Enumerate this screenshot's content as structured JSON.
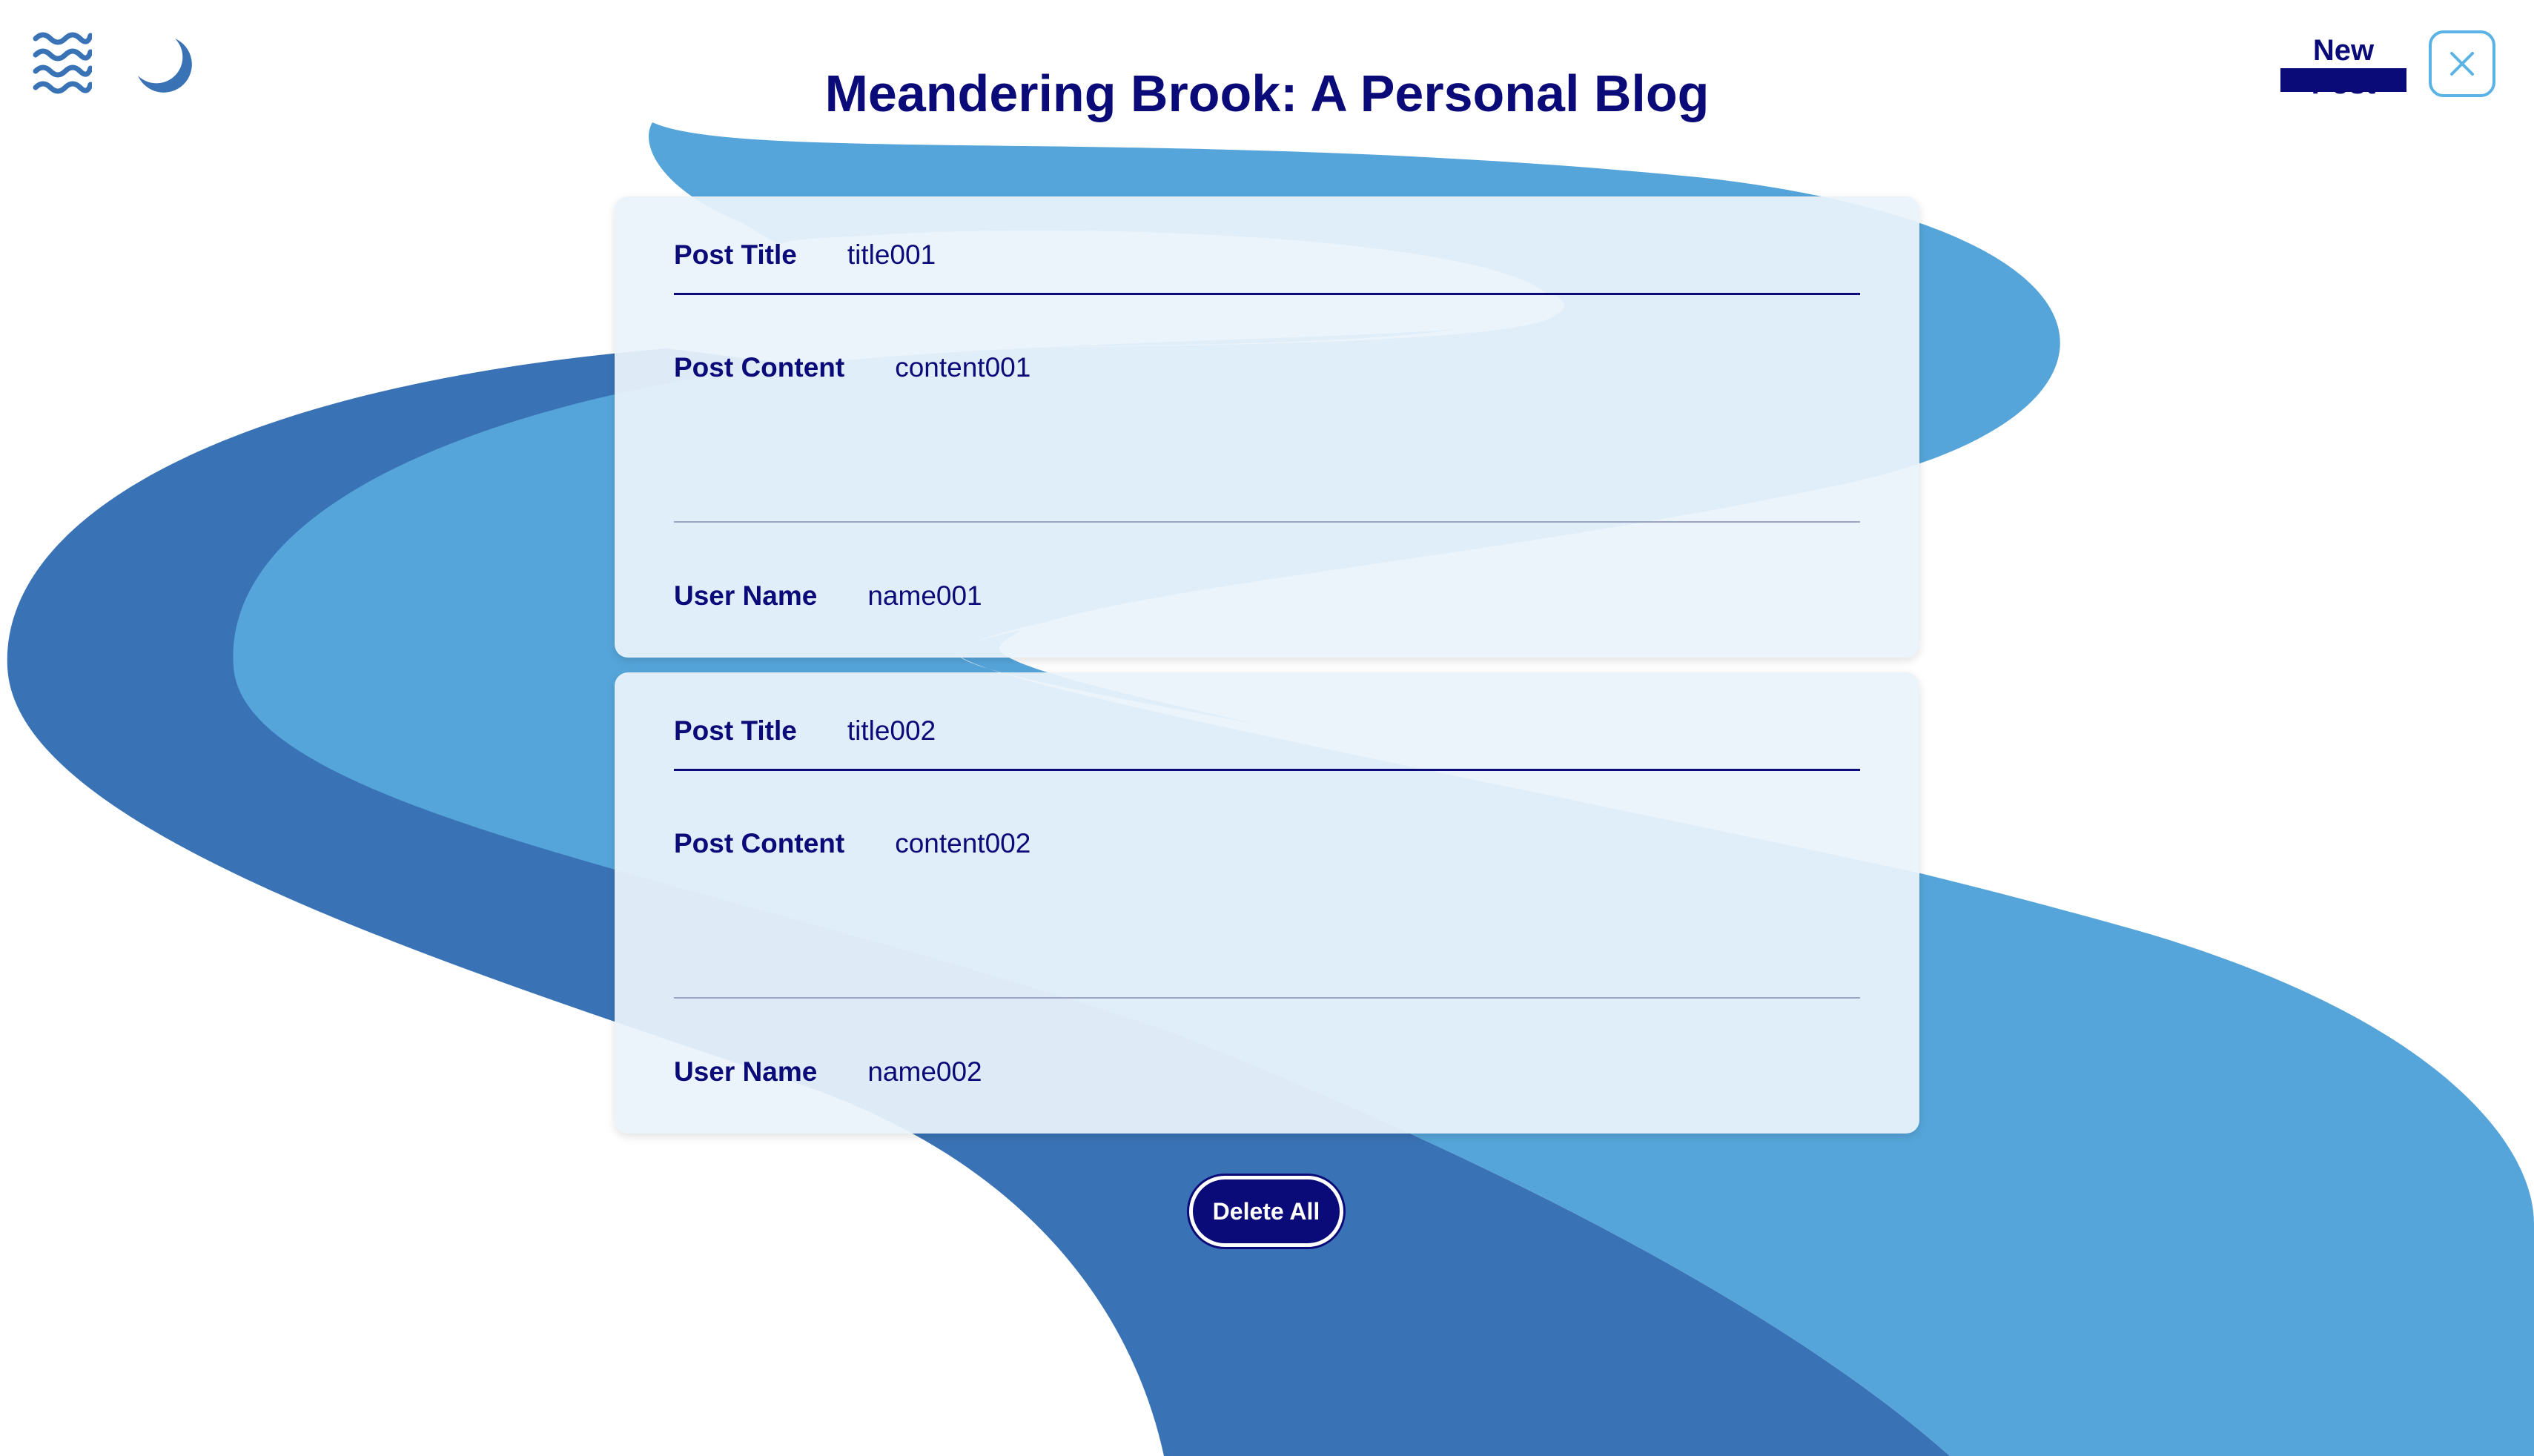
{
  "header": {
    "title": "Meandering Brook: A Personal Blog",
    "new_post_label": "New Post",
    "logo_icon": "waves-icon",
    "theme_icon": "moon-icon",
    "close_icon": "close-icon"
  },
  "posts": [
    {
      "title_label": "Post Title",
      "title_value": "title001",
      "content_label": "Post Content",
      "content_value": "content001",
      "user_label": "User Name",
      "user_value": "name001"
    },
    {
      "title_label": "Post Title",
      "title_value": "title002",
      "content_label": "Post Content",
      "content_value": "content002",
      "user_label": "User Name",
      "user_value": "name002"
    }
  ],
  "actions": {
    "delete_all_label": "Delete All"
  },
  "colors": {
    "navy": "#0a0a78",
    "river_dark": "#3a73b5",
    "river_light": "#55a5da",
    "card_bg": "#ebf3fb",
    "close_border": "#5bb2e4"
  }
}
